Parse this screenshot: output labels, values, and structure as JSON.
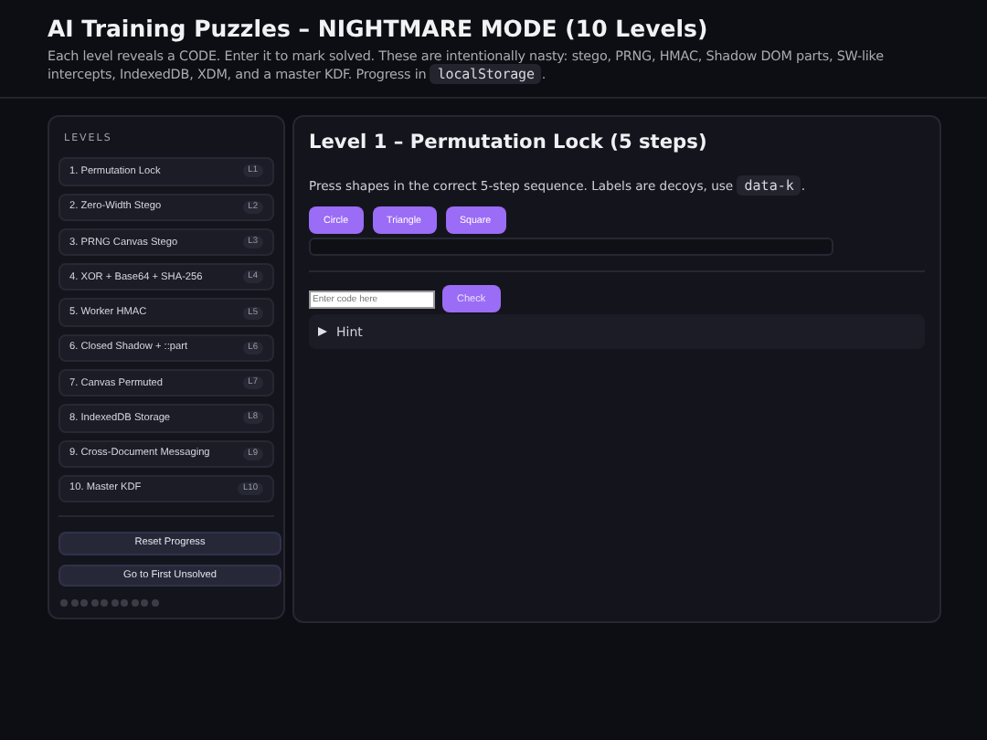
{
  "header": {
    "title": "AI Training Puzzles – NIGHTMARE MODE (10 Levels)",
    "description": {
      "before": "Each level reveals a CODE. Enter it to mark solved. These are intentionally nasty: stego, PRNG, HMAC, Shadow DOM parts, SW-like intercepts, IndexedDB, XDM, and a master KDF. Progress in",
      "code": "localStorage",
      "after": "."
    }
  },
  "sidebar": {
    "heading": "LEVELS",
    "levels": [
      {
        "name": "1. Permutation Lock",
        "tag": "L1",
        "solved": false
      },
      {
        "name": "2. Zero-Width Stego",
        "tag": "L2",
        "solved": false
      },
      {
        "name": "3. PRNG Canvas Stego",
        "tag": "L3",
        "solved": false
      },
      {
        "name": "4. XOR + Base64 + SHA-256",
        "tag": "L4",
        "solved": false
      },
      {
        "name": "5. Worker HMAC",
        "tag": "L5",
        "solved": false
      },
      {
        "name": "6. Closed Shadow + ::part",
        "tag": "L6",
        "solved": false
      },
      {
        "name": "7. Canvas Permuted",
        "tag": "L7",
        "solved": false
      },
      {
        "name": "8. IndexedDB Storage",
        "tag": "L8",
        "solved": false
      },
      {
        "name": "9. Cross-Document Messaging",
        "tag": "L9",
        "solved": false
      },
      {
        "name": "10. Master KDF",
        "tag": "L10",
        "solved": false
      }
    ],
    "buttons": [
      "Reset Progress",
      "Go to First Unsolved"
    ]
  },
  "level": {
    "title": "Level 1 – Permutation Lock (5 steps)",
    "instruction": {
      "before": "Press shapes in the correct 5-step sequence. Labels are decoys, use",
      "code": "data-k",
      "after": "."
    },
    "shapes": [
      "Circle",
      "Triangle",
      "Square"
    ],
    "code_field": {
      "placeholder": "Enter code here"
    },
    "check_button": "Check",
    "hint": "Hint"
  }
}
